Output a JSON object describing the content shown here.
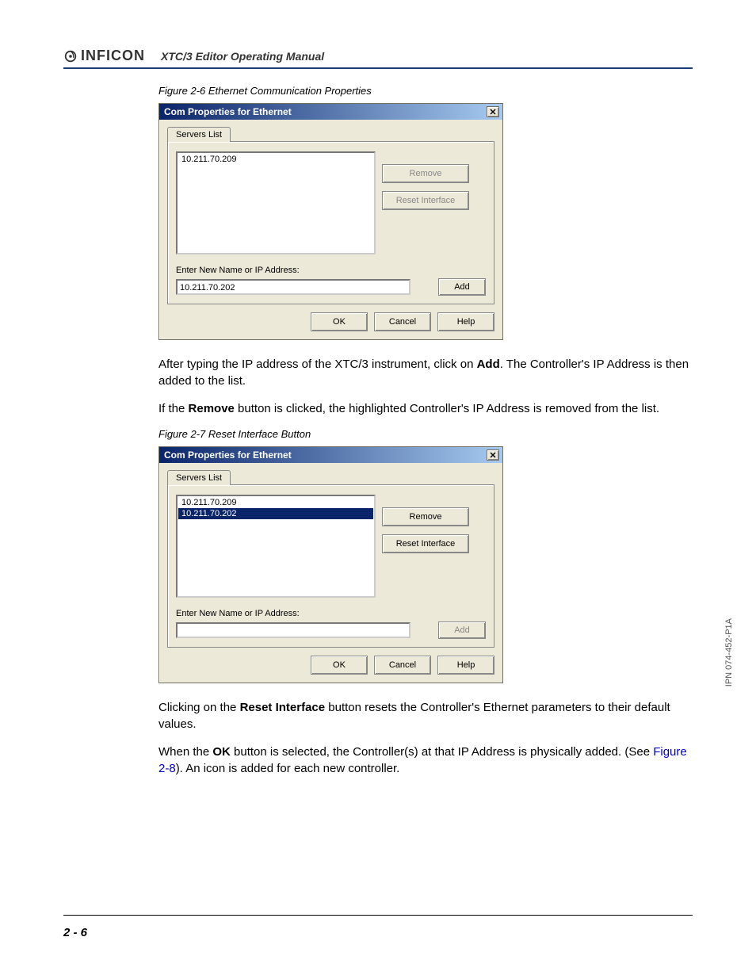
{
  "header": {
    "logo_text": "INFICON",
    "manual_title": "XTC/3 Editor Operating Manual"
  },
  "figure1": {
    "caption": "Figure 2-6  Ethernet Communication Properties",
    "dialog": {
      "title": "Com Properties for Ethernet",
      "tab_label": "Servers List",
      "list_items": [
        "10.211.70.209"
      ],
      "selected_index": -1,
      "remove_label": "Remove",
      "reset_label": "Reset Interface",
      "input_label": "Enter New Name or IP Address:",
      "input_value": "10.211.70.202",
      "add_label": "Add",
      "ok_label": "OK",
      "cancel_label": "Cancel",
      "help_label": "Help",
      "remove_disabled": true,
      "reset_disabled": true,
      "add_disabled": false
    }
  },
  "para1_a": "After typing the IP address of the XTC/3 instrument, click on ",
  "para1_bold": "Add",
  "para1_b": ". The Controller's IP Address is then added to the list.",
  "para2_a": "If the ",
  "para2_bold": "Remove",
  "para2_b": " button is clicked, the highlighted Controller's IP Address is removed from the list.",
  "figure2": {
    "caption": "Figure 2-7  Reset Interface Button",
    "dialog": {
      "title": "Com Properties for Ethernet",
      "tab_label": "Servers List",
      "list_items": [
        "10.211.70.209",
        "10.211.70.202"
      ],
      "selected_index": 1,
      "remove_label": "Remove",
      "reset_label": "Reset Interface",
      "input_label": "Enter New Name or IP Address:",
      "input_value": "",
      "add_label": "Add",
      "ok_label": "OK",
      "cancel_label": "Cancel",
      "help_label": "Help",
      "remove_disabled": false,
      "reset_disabled": false,
      "add_disabled": true
    }
  },
  "para3_a": "Clicking on the ",
  "para3_bold": "Reset Interface",
  "para3_b": " button resets the Controller's Ethernet parameters to their default values.",
  "para4_a": "When the ",
  "para4_bold": "OK",
  "para4_b": " button is selected, the Controller(s) at that IP Address is physically added. (See ",
  "para4_link": "Figure 2-8",
  "para4_c": "). An icon is added for each new controller.",
  "side_text": "IPN 074-452-P1A",
  "page_number": "2 - 6"
}
